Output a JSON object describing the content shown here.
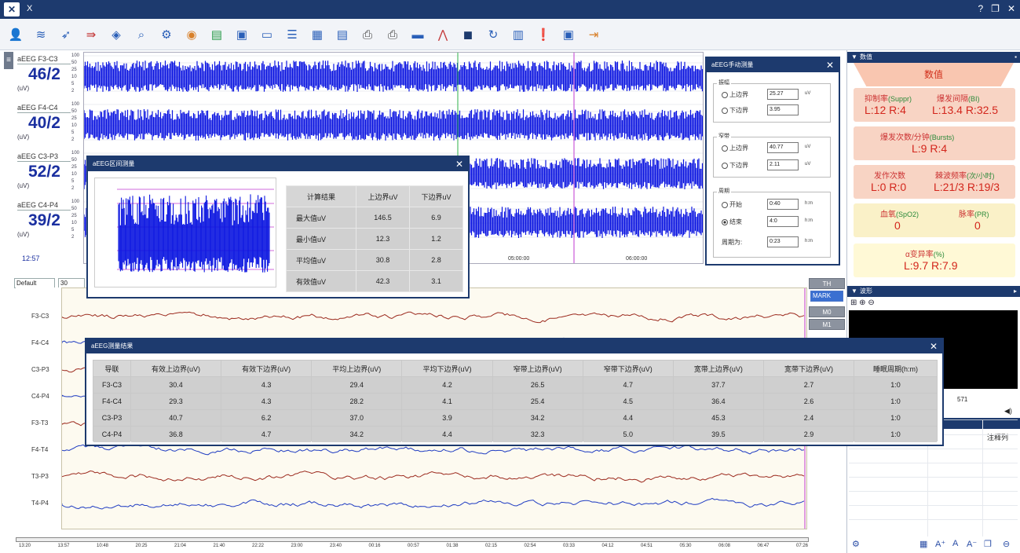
{
  "titlebar": {
    "title": "X",
    "controls": [
      "?",
      "❐",
      "✕"
    ]
  },
  "toolbar": {
    "icons": [
      "user-icon",
      "montage-icon",
      "filter-icon",
      "marker-icon",
      "layers-icon",
      "zoom-search-icon",
      "settings-gear-icon",
      "color-map-icon",
      "chart-bars-icon",
      "image-icon",
      "window-icon",
      "list-icon",
      "report-icon",
      "document-icon",
      "print-icon",
      "printer-icon",
      "band-icon",
      "spectrum-icon",
      "video-camera-icon",
      "refresh-icon",
      "book-icon",
      "alert-icon",
      "monitor-icon",
      "exit-icon"
    ]
  },
  "leads": [
    {
      "label": "aEEG F3-C3",
      "value": "46/2",
      "unit": "(uV)"
    },
    {
      "label": "aEEG F4-C4",
      "value": "40/2",
      "unit": "(uV)"
    },
    {
      "label": "aEEG C3-P3",
      "value": "52/2",
      "unit": "(uV)"
    },
    {
      "label": "aEEG C4-P4",
      "value": "39/2",
      "unit": "(uV)"
    }
  ],
  "side_time": "12:57",
  "trend_scale": [
    "100",
    "50",
    "25",
    "10",
    "5",
    "2"
  ],
  "trend_times": [
    "05:00:00",
    "06:00:00"
  ],
  "raw_controls": {
    "montage": "Default",
    "speed": "30 mm/s"
  },
  "raw_leads": [
    "F3-C3",
    "F4-C4",
    "C3-P3",
    "C4-P4",
    "F3-T3",
    "F4-T4",
    "T3-P3",
    "T4-P4"
  ],
  "right_buttons": {
    "top": "TH",
    "select": "MARK",
    "m0": "M0",
    "m1": "M1"
  },
  "timeline": [
    "13:20",
    "13:57",
    "10:48",
    "20:25",
    "21:04",
    "21:40",
    "22:22",
    "23:00",
    "23:40",
    "00:16",
    "00:57",
    "01:38",
    "02:15",
    "02:54",
    "03:33",
    "04:12",
    "04:51",
    "05:30",
    "06:08",
    "06:47",
    "07:26"
  ],
  "right_panel": {
    "values_head": "数值",
    "banner": "数值",
    "cards": [
      {
        "h1": "抑制率",
        "h1en": "(Suppr)",
        "h2": "爆发间隔",
        "h2en": "(BI)",
        "v1": "L:12 R:4",
        "v2": "L:13.4 R:32.5"
      },
      {
        "h1": "爆发次数/分钟",
        "h1en": "(Bursts)",
        "v1": "L:9 R:4"
      },
      {
        "h1": "发作次数",
        "h2": "棘波频率",
        "h2en": "(次/小时)",
        "v1": "L:0 R:0",
        "v2": "L:21/3 R:19/3"
      },
      {
        "h1": "血氧",
        "h1en": "(SpO2)",
        "h2": "脉率",
        "h2en": "(PR)",
        "v1": "0",
        "v2": "0"
      },
      {
        "h1": "α变异率",
        "h1en": "(%)",
        "v1": "L:9.7 R:7.9"
      }
    ],
    "wave_head": "波形",
    "wave_tools": "⊞ ⊕ ⊖",
    "side_num": "571",
    "list_head": "注释列",
    "bottom_icons": [
      "gear-icon",
      "calendar-icon",
      "font-up-icon",
      "font-icon",
      "font-down-icon",
      "copy-icon",
      "minus-circle-icon"
    ]
  },
  "dlg_interval": {
    "title": "aEEG区间测量",
    "headers": [
      "计算结果",
      "上边界uV",
      "下边界uV"
    ],
    "rows": [
      [
        "最大值uV",
        "146.5",
        "6.9"
      ],
      [
        "最小值uV",
        "12.3",
        "1.2"
      ],
      [
        "平均值uV",
        "30.8",
        "2.8"
      ],
      [
        "有效值uV",
        "42.3",
        "3.1"
      ]
    ]
  },
  "dlg_manual": {
    "title": "aEEG手动测量",
    "g1": "振幅",
    "g1_upper": "上边界",
    "g1_upper_val": "25.27",
    "g1_lower": "下边界",
    "g1_lower_val": "3.95",
    "g2": "窄带",
    "g2_upper": "上边界",
    "g2_upper_val": "40.77",
    "g2_lower": "下边界",
    "g2_lower_val": "2.11",
    "g3": "周期",
    "g3_start": "开始",
    "g3_start_val": "0:40",
    "g3_end": "结束",
    "g3_end_val": "4:0",
    "g3_period": "周期为:",
    "g3_period_val": "0:23",
    "unit_uv": "uV",
    "unit_hcm": "h:m"
  },
  "dlg_table": {
    "title": "aEEG测量结果",
    "headers": [
      "导联",
      "有效上边界(uV)",
      "有效下边界(uV)",
      "平均上边界(uV)",
      "平均下边界(uV)",
      "窄带上边界(uV)",
      "窄带下边界(uV)",
      "宽带上边界(uV)",
      "宽带下边界(uV)",
      "睡眠周期(h:m)"
    ],
    "rows": [
      [
        "F3-C3",
        "30.4",
        "4.3",
        "29.4",
        "4.2",
        "26.5",
        "4.7",
        "37.7",
        "2.7",
        "1:0"
      ],
      [
        "F4-C4",
        "29.3",
        "4.3",
        "28.2",
        "4.1",
        "25.4",
        "4.5",
        "36.4",
        "2.6",
        "1:0"
      ],
      [
        "C3-P3",
        "40.7",
        "6.2",
        "37.0",
        "3.9",
        "34.2",
        "4.4",
        "45.3",
        "2.4",
        "1:0"
      ],
      [
        "C4-P4",
        "36.8",
        "4.7",
        "34.2",
        "4.4",
        "32.3",
        "5.0",
        "39.5",
        "2.9",
        "1:0"
      ]
    ]
  },
  "colors": {
    "titlebar": "#1d3a6e",
    "trend": "#0a14e0",
    "accent": "#d12f1b"
  }
}
